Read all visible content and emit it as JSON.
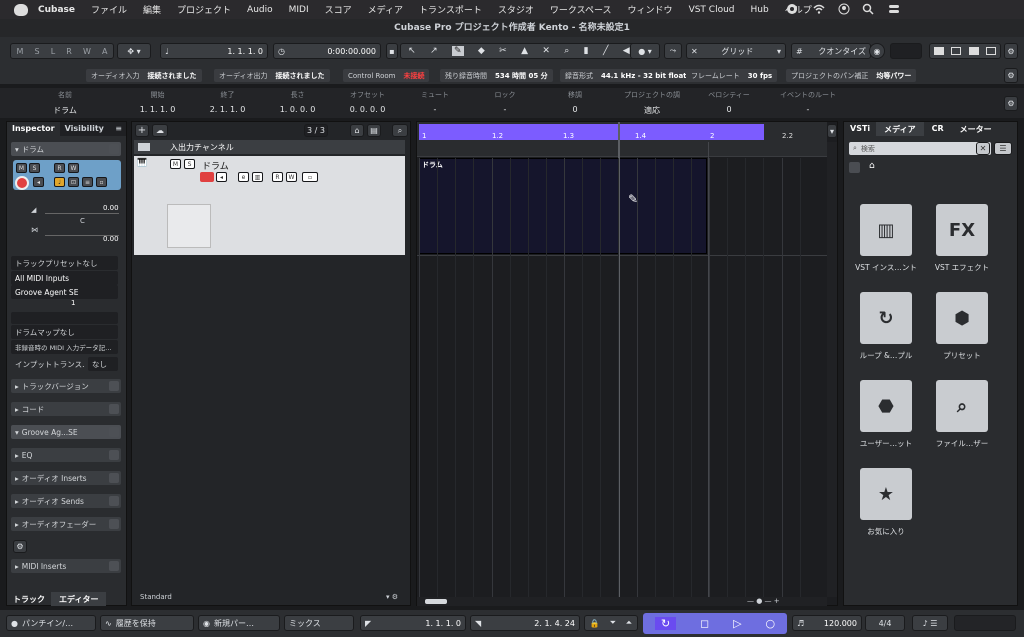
{
  "menubar": {
    "app": "Cubase",
    "items": [
      "ファイル",
      "編集",
      "プロジェクト",
      "Audio",
      "MIDI",
      "スコア",
      "メディア",
      "トランスポート",
      "スタジオ",
      "ワークスペース",
      "ウィンドウ",
      "VST Cloud",
      "Hub",
      "ヘルプ"
    ]
  },
  "window": {
    "title": "Cubase Pro プロジェクト作成者 Kento - 名称未設定1"
  },
  "toolbar": {
    "msr": [
      "M",
      "S",
      "L",
      "R",
      "W",
      "A"
    ],
    "position": "1.  1.  1.    0",
    "time": "0:00:00.000",
    "grid_label": "グリッド",
    "quantize_label": "クオンタイズ"
  },
  "status": [
    {
      "label": "オーディオ入力",
      "value": "接続されました"
    },
    {
      "label": "オーディオ出力",
      "value": "接続されました"
    },
    {
      "label": "Control Room",
      "value": "未接続",
      "warn": true
    },
    {
      "label": "残り録音時間",
      "value": "534 時間 05 分"
    },
    {
      "label": "録音形式",
      "value": "44.1 kHz - 32 bit float"
    },
    {
      "label": "フレームレート",
      "value": "30 fps"
    },
    {
      "label": "プロジェクトのパン補正",
      "value": "均等パワー"
    }
  ],
  "info": [
    {
      "label": "名前",
      "value": "ドラム"
    },
    {
      "label": "開始",
      "value": "1. 1. 1.  0"
    },
    {
      "label": "終了",
      "value": "2. 1. 1.  0"
    },
    {
      "label": "長さ",
      "value": "1. 0. 0.  0"
    },
    {
      "label": "オフセット",
      "value": "0. 0. 0.  0"
    },
    {
      "label": "ミュート",
      "value": "-"
    },
    {
      "label": "ロック",
      "value": "-"
    },
    {
      "label": "移調",
      "value": "0"
    },
    {
      "label": "プロジェクトの調",
      "value": "適応"
    },
    {
      "label": "ベロシティー",
      "value": "0"
    },
    {
      "label": "イベントのルート",
      "value": "-"
    }
  ],
  "inspector": {
    "tab1": "Inspector",
    "tab2": "Visibility",
    "track_name": "ドラム",
    "vol": "0.00",
    "pan_c": "C",
    "pan": "0.00",
    "preset": "トラックプリセットなし",
    "midi_in": "All MIDI Inputs",
    "instrument": "Groove Agent SE",
    "channel": "1",
    "drum_map": "ドラムマップなし",
    "midi_note": "非録音時の MIDI 入力データ記…",
    "input_transform": "インプットトランス.",
    "none": "なし",
    "sections": [
      "トラックバージョン",
      "コード",
      "Groove Ag...SE",
      "EQ",
      "オーディオ Inserts",
      "オーディオ Sends",
      "オーディオフェーダー"
    ],
    "midi_inserts": "MIDI Inserts",
    "bottom_tabs": [
      "トラック",
      "エディター"
    ]
  },
  "tracklist": {
    "count": "3 / 3",
    "folder": "入出力チャンネル",
    "track": "ドラム",
    "footer": "Standard"
  },
  "arrange": {
    "ruler": [
      "1",
      "1.2",
      "1.3",
      "1.4",
      "2",
      "2.2"
    ],
    "event": "ドラム"
  },
  "media": {
    "tabs": [
      "VSTi",
      "メディア",
      "CR",
      "メーター"
    ],
    "search": "検索",
    "items": [
      {
        "label": "VST インス…ント",
        "icon": "piano-icon"
      },
      {
        "label": "VST エフェクト",
        "icon": "fx-icon"
      },
      {
        "label": "ループ &…プル",
        "icon": "loop-icon"
      },
      {
        "label": "プリセット",
        "icon": "preset-icon"
      },
      {
        "label": "ユーザー…ット",
        "icon": "user-icon"
      },
      {
        "label": "ファイル…ザー",
        "icon": "file-browser-icon"
      },
      {
        "label": "お気に入り",
        "icon": "star-icon"
      }
    ]
  },
  "bottom": {
    "punch": "パンチイン/…",
    "history": "履歴を保持",
    "new_part": "新規パー…",
    "mix": "ミックス",
    "left_loc": "1.  1.  1.    0",
    "right_loc": "2.  1.  4.   24",
    "tempo": "120.000",
    "sig": "4/4"
  },
  "colors": {
    "accent": "#7c5cff",
    "event": "#15152c"
  }
}
